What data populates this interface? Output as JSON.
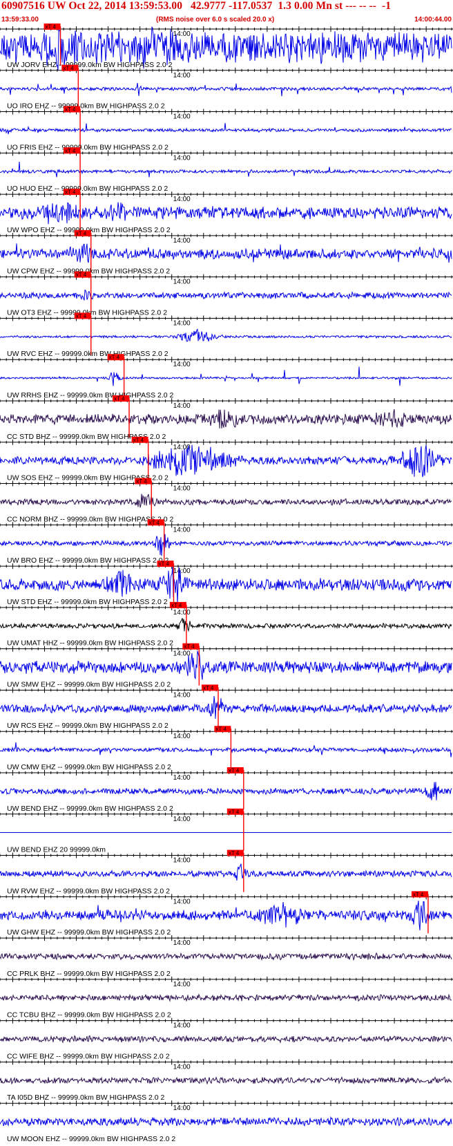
{
  "header": {
    "title": "60907516 UW Oct 22, 2014 13:59:53.00   42.9777 -117.0537  1.3 0.00 Mn st --- -- --  -1",
    "start_time": "13:59:33.00",
    "note": "(RMS noise over 6.0 s scaled 20.0 x)",
    "end_time": "14:00:44.00"
  },
  "colors": {
    "header_text": "#d40000",
    "pick_marker": "#ff0000",
    "blue_trace": "#0000e6",
    "purple_trace": "#2b0f4f",
    "black_trace": "#000000",
    "axis": "#000000"
  },
  "chart_data": {
    "type": "line",
    "title": "60907516 UW Oct 22, 2014 13:59:53.00   42.9777 -117.0537  1.3 0.00 Mn st --- -- --  -1",
    "x_range": [
      "13:59:33.00",
      "14:00:44.00"
    ],
    "x_tick_label": "14:00",
    "x_tick_label_time": "14:00:00",
    "pick_label": "xT 4",
    "grid": false,
    "legend": "none",
    "traces": [
      {
        "label": "UW JORV EHZ -- 99999.0km BW  HIGHPASS  2.0  2",
        "color": "#0000e6",
        "pick_time": "13:59:41.2",
        "amplitude": 0.75,
        "bursts": [
          {
            "t": "13:59:43",
            "amp": 0.55,
            "width_s": 6
          },
          {
            "t": "13:59:58",
            "amp": 0.8,
            "width_s": 5
          }
        ],
        "spiky": false
      },
      {
        "label": "UO IRO EHZ -- 99999.0km BW  HIGHPASS  2.0  2",
        "color": "#0000e6",
        "pick_time": "13:59:44.0",
        "amplitude": 0.08,
        "bursts": [],
        "spiky": true
      },
      {
        "label": "UO FRIS EHZ -- 99999.0km BW  HIGHPASS  2.0  2",
        "color": "#0000e6",
        "pick_time": "13:59:44.3",
        "amplitude": 0.08,
        "bursts": [],
        "spiky": true
      },
      {
        "label": "UO HUO EHZ -- 99999.0km BW  HIGHPASS  2.0  2",
        "color": "#0000e6",
        "pick_time": "13:59:44.3",
        "amplitude": 0.08,
        "bursts": [],
        "spiky": true
      },
      {
        "label": "UW WPO EHZ -- 99999.0km BW  HIGHPASS  2.0  2",
        "color": "#0000e6",
        "pick_time": "13:59:44.3",
        "amplitude": 0.3,
        "bursts": [
          {
            "t": "13:59:42",
            "amp": 0.4,
            "width_s": 6
          },
          {
            "t": "13:59:52",
            "amp": 0.25,
            "width_s": 4
          }
        ],
        "spiky": false
      },
      {
        "label": "UW CPW EHZ -- 99999.0km BW  HIGHPASS  2.0  2",
        "color": "#0000e6",
        "pick_time": "13:59:46.0",
        "amplitude": 0.25,
        "bursts": [
          {
            "t": "13:59:46",
            "amp": 0.4,
            "width_s": 3
          }
        ],
        "spiky": true
      },
      {
        "label": "UW OT3 EHZ -- 99999.0km BW  HIGHPASS  2.0  2",
        "color": "#0000e6",
        "pick_time": "13:59:46.0",
        "amplitude": 0.15,
        "bursts": [
          {
            "t": "13:59:46.5",
            "amp": 0.2,
            "width_s": 2
          }
        ],
        "spiky": false
      },
      {
        "label": "UW RVC EHZ -- 99999.0km BW  HIGHPASS  2.0  2",
        "color": "#0000e6",
        "pick_time": "13:59:46.0",
        "amplitude": 0.06,
        "bursts": [
          {
            "t": "14:00:04",
            "amp": 0.3,
            "width_s": 6
          }
        ],
        "spiky": false
      },
      {
        "label": "UW RRHS EHZ -- 99999.0km BW  HIGHPASS  2.0  2",
        "color": "#0000e6",
        "pick_time": "13:59:51.2",
        "amplitude": 0.05,
        "bursts": [
          {
            "t": "13:59:51",
            "amp": 0.35,
            "width_s": 2
          }
        ],
        "spiky": true
      },
      {
        "label": "CC STD BHZ -- 99999.0km BW  HIGHPASS  2.0  2",
        "color": "#2b0f4f",
        "pick_time": "13:59:52.0",
        "amplitude": 0.25,
        "bursts": [
          {
            "t": "14:00:09",
            "amp": 0.3,
            "width_s": 6
          },
          {
            "t": "14:00:35",
            "amp": 0.3,
            "width_s": 6
          }
        ],
        "spiky": false
      },
      {
        "label": "UW SOS EHZ -- 99999.0km BW  HIGHPASS  2.0  2",
        "color": "#0000e6",
        "pick_time": "13:59:55.0",
        "amplitude": 0.2,
        "bursts": [
          {
            "t": "14:00:03",
            "amp": 0.85,
            "width_s": 12
          },
          {
            "t": "14:00:39",
            "amp": 0.8,
            "width_s": 6
          }
        ],
        "spiky": false
      },
      {
        "label": "CC NORM BHZ -- 99999.0km BW  HIGHPASS  2.0  2",
        "color": "#2b0f4f",
        "pick_time": "13:59:55.5",
        "amplitude": 0.15,
        "bursts": [
          {
            "t": "13:59:56",
            "amp": 0.35,
            "width_s": 3
          }
        ],
        "spiky": false
      },
      {
        "label": "UW BRO EHZ -- 99999.0km BW  HIGHPASS  2.0  2",
        "color": "#0000e6",
        "pick_time": "13:59:57.5",
        "amplitude": 0.12,
        "bursts": [
          {
            "t": "13:59:58.5",
            "amp": 0.8,
            "width_s": 2
          }
        ],
        "spiky": false
      },
      {
        "label": "UW STD EHZ -- 99999.0km BW  HIGHPASS  2.0  2",
        "color": "#0000e6",
        "pick_time": "13:59:59.0",
        "amplitude": 0.3,
        "bursts": [
          {
            "t": "13:59:52",
            "amp": 0.5,
            "width_s": 4
          },
          {
            "t": "14:00:00",
            "amp": 0.9,
            "width_s": 4
          }
        ],
        "spiky": false
      },
      {
        "label": "UW UMAT HHZ -- 99999.0km BW  HIGHPASS  2.0  2",
        "color": "#000000",
        "pick_time": "14:00:01.0",
        "amplitude": 0.12,
        "bursts": [
          {
            "t": "14:00:02",
            "amp": 0.45,
            "width_s": 2
          }
        ],
        "spiky": false
      },
      {
        "label": "UW SMW EHZ -- 99999.0km BW  HIGHPASS  2.0  2",
        "color": "#0000e6",
        "pick_time": "14:00:03.0",
        "amplitude": 0.3,
        "bursts": [
          {
            "t": "14:00:04",
            "amp": 0.6,
            "width_s": 4
          }
        ],
        "spiky": false
      },
      {
        "label": "UW RCS EHZ -- 99999.0km BW  HIGHPASS  2.0  2",
        "color": "#0000e6",
        "pick_time": "14:00:06.0",
        "amplitude": 0.2,
        "bursts": [
          {
            "t": "14:00:07",
            "amp": 0.5,
            "width_s": 3
          }
        ],
        "spiky": false
      },
      {
        "label": "UW CMW EHZ -- 99999.0km BW  HIGHPASS  2.0  2",
        "color": "#0000e6",
        "pick_time": "14:00:08.0",
        "amplitude": 0.1,
        "bursts": [],
        "spiky": true
      },
      {
        "label": "UW BEND EHZ -- 99999.0km BW  HIGHPASS  2.0  2",
        "color": "#0000e6",
        "pick_time": "14:00:10.0",
        "amplitude": 0.15,
        "bursts": [
          {
            "t": "14:00:41",
            "amp": 0.5,
            "width_s": 2
          }
        ],
        "spiky": false
      },
      {
        "label": "UW BEND EHZ 20 99999.0km",
        "color": "#0000e6",
        "pick_time": "14:00:10.0",
        "amplitude": 0.0,
        "bursts": [],
        "spiky": false
      },
      {
        "label": "UW RVW EHZ -- 99999.0km BW  HIGHPASS  2.0  2",
        "color": "#0000e6",
        "pick_time": "14:00:10.0",
        "amplitude": 0.15,
        "bursts": [
          {
            "t": "14:00:11",
            "amp": 0.4,
            "width_s": 2
          }
        ],
        "spiky": false
      },
      {
        "label": "UW GHW EHZ -- 99999.0km BW  HIGHPASS  2.0  2",
        "color": "#0000e6",
        "pick_time": "14:00:39.0",
        "amplitude": 0.25,
        "bursts": [
          {
            "t": "14:00:17",
            "amp": 0.5,
            "width_s": 6
          },
          {
            "t": "14:00:39",
            "amp": 0.6,
            "width_s": 3
          }
        ],
        "spiky": true
      },
      {
        "label": "CC PRLK BHZ -- 99999.0km BW  HIGHPASS  2.0  2",
        "color": "#2b0f4f",
        "pick_time": "",
        "amplitude": 0.15,
        "bursts": [],
        "spiky": false
      },
      {
        "label": "CC TCBU BHZ -- 99999.0km BW  HIGHPASS  2.0  2",
        "color": "#2b0f4f",
        "pick_time": "",
        "amplitude": 0.15,
        "bursts": [],
        "spiky": false
      },
      {
        "label": "CC WIFE BHZ -- 99999.0km BW  HIGHPASS  2.0  2",
        "color": "#2b0f4f",
        "pick_time": "",
        "amplitude": 0.15,
        "bursts": [],
        "spiky": false
      },
      {
        "label": "TA I05D BHZ -- 99999.0km BW  HIGHPASS  2.0  2",
        "color": "#2b0f4f",
        "pick_time": "",
        "amplitude": 0.15,
        "bursts": [],
        "spiky": false
      },
      {
        "label": "UW MOON EHZ -- 99999.0km BW  HIGHPASS  2.0  2",
        "color": "#0000e6",
        "pick_time": "",
        "amplitude": 0.2,
        "bursts": [],
        "spiky": false
      }
    ]
  }
}
